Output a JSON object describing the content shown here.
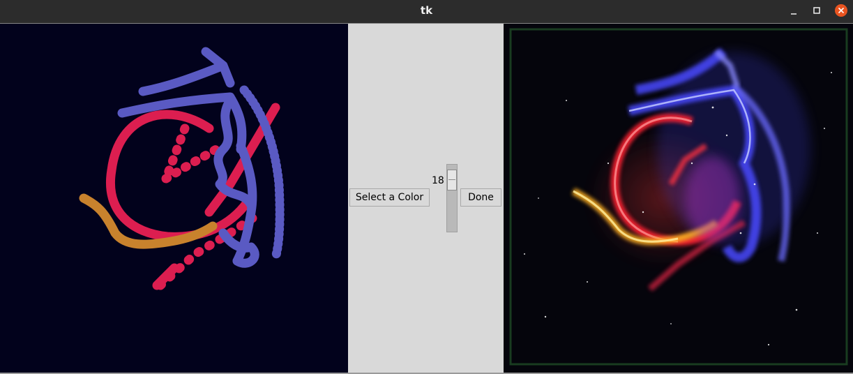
{
  "window": {
    "title": "tk"
  },
  "controls": {
    "select_color_label": "Select a Color",
    "done_label": "Done",
    "brush_size": "18"
  },
  "colors": {
    "canvas_bg": "#02021c",
    "stroke_red": "#dc1e50",
    "stroke_blue": "#5a5ac3",
    "stroke_orange": "#c8822d",
    "close_button": "#e95420"
  }
}
